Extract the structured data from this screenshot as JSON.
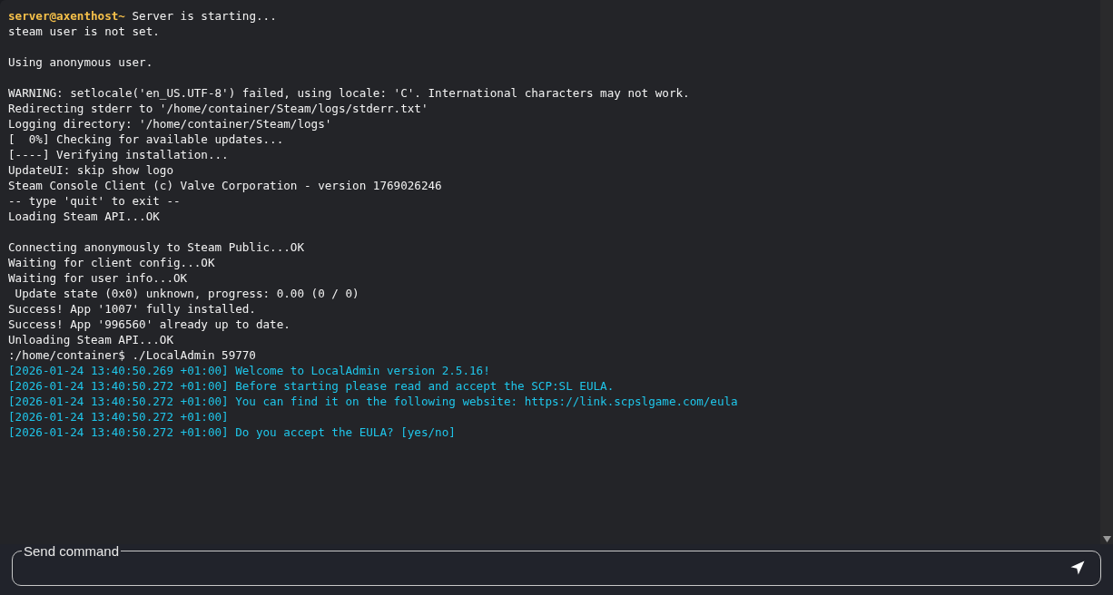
{
  "console": {
    "lines": [
      {
        "kind": "prompt",
        "prompt": "server@axenthost~",
        "text": "Server is starting..."
      },
      {
        "kind": "output",
        "text": "steam user is not set."
      },
      {
        "kind": "blank"
      },
      {
        "kind": "output",
        "text": "Using anonymous user."
      },
      {
        "kind": "blank"
      },
      {
        "kind": "output",
        "text": "WARNING: setlocale('en_US.UTF-8') failed, using locale: 'C'. International characters may not work."
      },
      {
        "kind": "output",
        "text": "Redirecting stderr to '/home/container/Steam/logs/stderr.txt'"
      },
      {
        "kind": "output",
        "text": "Logging directory: '/home/container/Steam/logs'"
      },
      {
        "kind": "output",
        "text": "[  0%] Checking for available updates..."
      },
      {
        "kind": "output",
        "text": "[----] Verifying installation..."
      },
      {
        "kind": "output",
        "text": "UpdateUI: skip show logo"
      },
      {
        "kind": "output",
        "text": "Steam Console Client (c) Valve Corporation - version 1769026246"
      },
      {
        "kind": "output",
        "text": "-- type 'quit' to exit --"
      },
      {
        "kind": "output",
        "text": "Loading Steam API...OK"
      },
      {
        "kind": "blank"
      },
      {
        "kind": "output",
        "text": "Connecting anonymously to Steam Public...OK"
      },
      {
        "kind": "output",
        "text": "Waiting for client config...OK"
      },
      {
        "kind": "output",
        "text": "Waiting for user info...OK"
      },
      {
        "kind": "output",
        "text": " Update state (0x0) unknown, progress: 0.00 (0 / 0)"
      },
      {
        "kind": "output",
        "text": "Success! App '1007' fully installed."
      },
      {
        "kind": "output",
        "text": "Success! App '996560' already up to date."
      },
      {
        "kind": "output",
        "text": "Unloading Steam API...OK"
      },
      {
        "kind": "output",
        "text": ":/home/container$ ./LocalAdmin 59770"
      },
      {
        "kind": "info",
        "text": "[2026-01-24 13:40:50.269 +01:00] Welcome to LocalAdmin version 2.5.16!"
      },
      {
        "kind": "info",
        "text": "[2026-01-24 13:40:50.272 +01:00] Before starting please read and accept the SCP:SL EULA."
      },
      {
        "kind": "info",
        "text": "[2026-01-24 13:40:50.272 +01:00] You can find it on the following website: https://link.scpslgame.com/eula"
      },
      {
        "kind": "info",
        "text": "[2026-01-24 13:40:50.272 +01:00]"
      },
      {
        "kind": "info",
        "text": "[2026-01-24 13:40:50.272 +01:00] Do you accept the EULA? [yes/no]"
      }
    ]
  },
  "command": {
    "placeholder": "Send command"
  }
}
